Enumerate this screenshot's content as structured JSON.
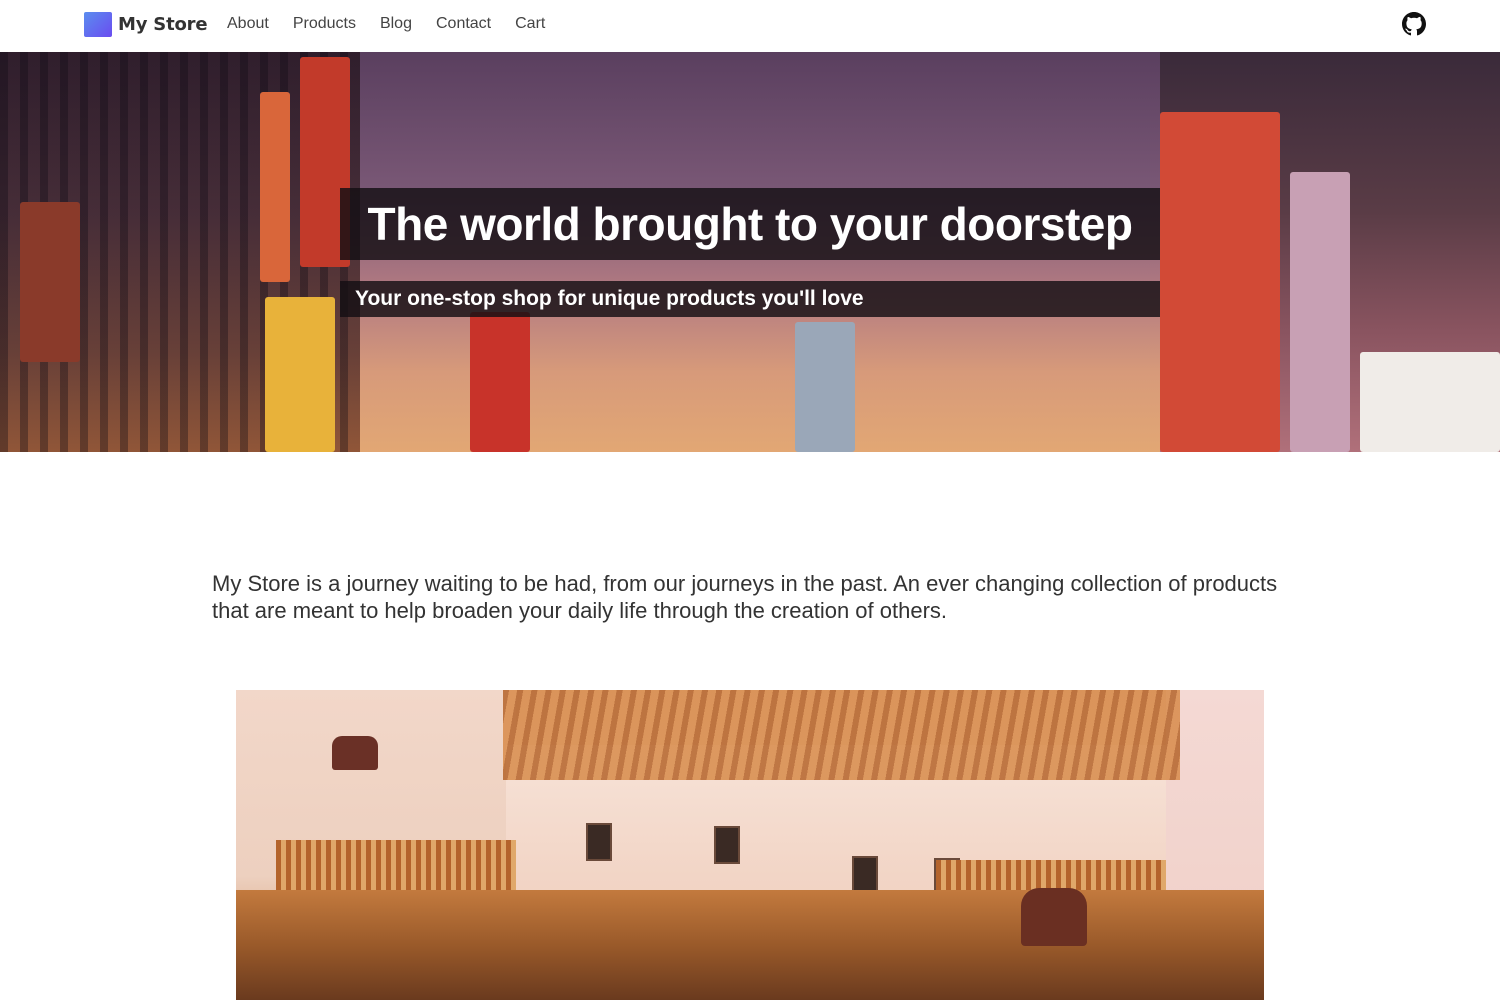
{
  "brand": {
    "name": "My Store"
  },
  "nav": {
    "links": [
      "About",
      "Products",
      "Blog",
      "Contact",
      "Cart"
    ]
  },
  "hero": {
    "title": "The world brought to your doorstep",
    "subtitle": "Your one-stop shop for unique products you'll love"
  },
  "intro": {
    "text": "My Store is a journey waiting to be had, from our journeys in the past. An ever changing collection of products that are meant to help broaden your daily life through the creation of others."
  },
  "icons": {
    "repo": "github-icon",
    "logo": "store-logo-icon"
  },
  "colors": {
    "brand_gradient_start": "#5b8def",
    "brand_gradient_end": "#6a4cf0",
    "hero_text": "#ffffff",
    "hero_box": "#140f14"
  }
}
